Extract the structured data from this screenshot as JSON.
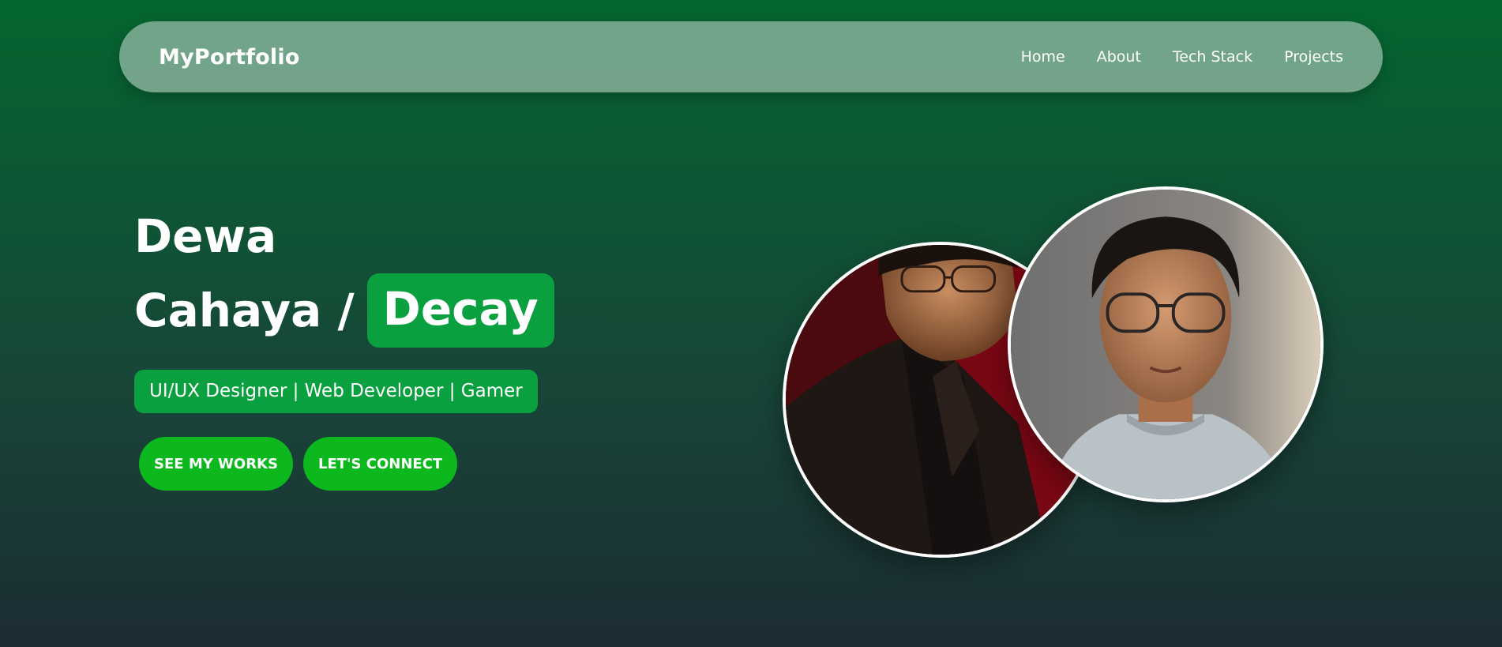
{
  "nav": {
    "brand": "MyPortfolio",
    "links": [
      "Home",
      "About",
      "Tech Stack",
      "Projects"
    ]
  },
  "hero": {
    "first_name": "Dewa",
    "second_line": "Cahaya /",
    "nickname": "Decay",
    "roles": "UI/UX Designer | Web Developer | Gamer",
    "buttons": {
      "works": "SEE MY WORKS",
      "connect": "LET'S CONNECT"
    }
  },
  "colors": {
    "accent": "#0aa040",
    "button": "#0cb81d",
    "gradient_top": "#04662f",
    "gradient_bottom": "#1c2c33"
  },
  "images": {
    "left": "portrait-dark-suit-red-background",
    "right": "portrait-glasses-selfie"
  }
}
